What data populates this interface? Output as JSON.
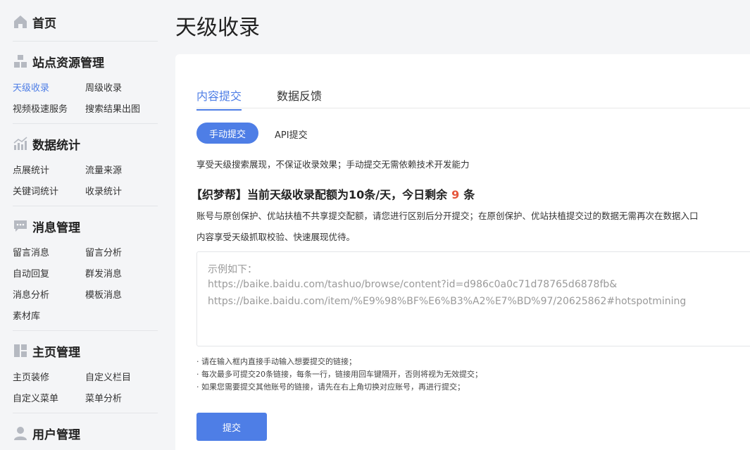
{
  "sidebar": {
    "home": {
      "label": "首页",
      "icon": "home-icon"
    },
    "groups": [
      {
        "title": "站点资源管理",
        "icon": "site-resource-icon",
        "items": [
          "天级收录",
          "周级收录",
          "视频极速服务",
          "搜索结果出图"
        ]
      },
      {
        "title": "数据统计",
        "icon": "stats-icon",
        "items": [
          "点展统计",
          "流量来源",
          "关键词统计",
          "收录统计"
        ]
      },
      {
        "title": "消息管理",
        "icon": "message-icon",
        "items": [
          "留言消息",
          "留言分析",
          "自动回复",
          "群发消息",
          "消息分析",
          "模板消息",
          "素材库"
        ]
      },
      {
        "title": "主页管理",
        "icon": "homepage-manage-icon",
        "items": [
          "主页装修",
          "自定义栏目",
          "自定义菜单",
          "菜单分析"
        ]
      },
      {
        "title": "用户管理",
        "icon": "user-icon",
        "items": []
      }
    ],
    "active_item": "天级收录",
    "accent": "#4e7ee6"
  },
  "main": {
    "title": "天级收录",
    "tabs": [
      "内容提交",
      "数据反馈"
    ],
    "submode": {
      "active": "手动提交",
      "other": "API提交"
    },
    "description": "享受天级搜索展现，不保证收录效果；手动提交无需依赖技术开发能力",
    "quota": {
      "prefix": "【织梦帮】当前天级收录配额为10条/天，今日剩余",
      "count": "9",
      "suffix": "条"
    },
    "note_line1": "账号与原创保护、优站扶植不共享提交配额，请您进行区别后分开提交；在原创保护、优站扶植提交过的数据无需再次在数据入口",
    "note_line2": "内容享受天级抓取校验、快速展现优待。",
    "textarea": {
      "placeholder_lines": [
        "示例如下：",
        "https://baike.baidu.com/tashuo/browse/content?id=d986c0a0c71d78765d6878fb&",
        "https://baike.baidu.com/item/%E9%98%BF%E6%B3%A2%E7%BD%97/20625862#hotspotmining"
      ]
    },
    "hints": [
      "· 请在输入框内直接手动输入想要提交的链接；",
      "· 每次最多可提交20条链接，每条一行，链接用回车键隔开，否则将视为无效提交；",
      "· 如果您需要提交其他账号的链接，请先在右上角切换对应账号，再进行提交；"
    ],
    "submit_label": "提交",
    "accent": "#4e7ee6",
    "highlight": "#e5563c"
  }
}
